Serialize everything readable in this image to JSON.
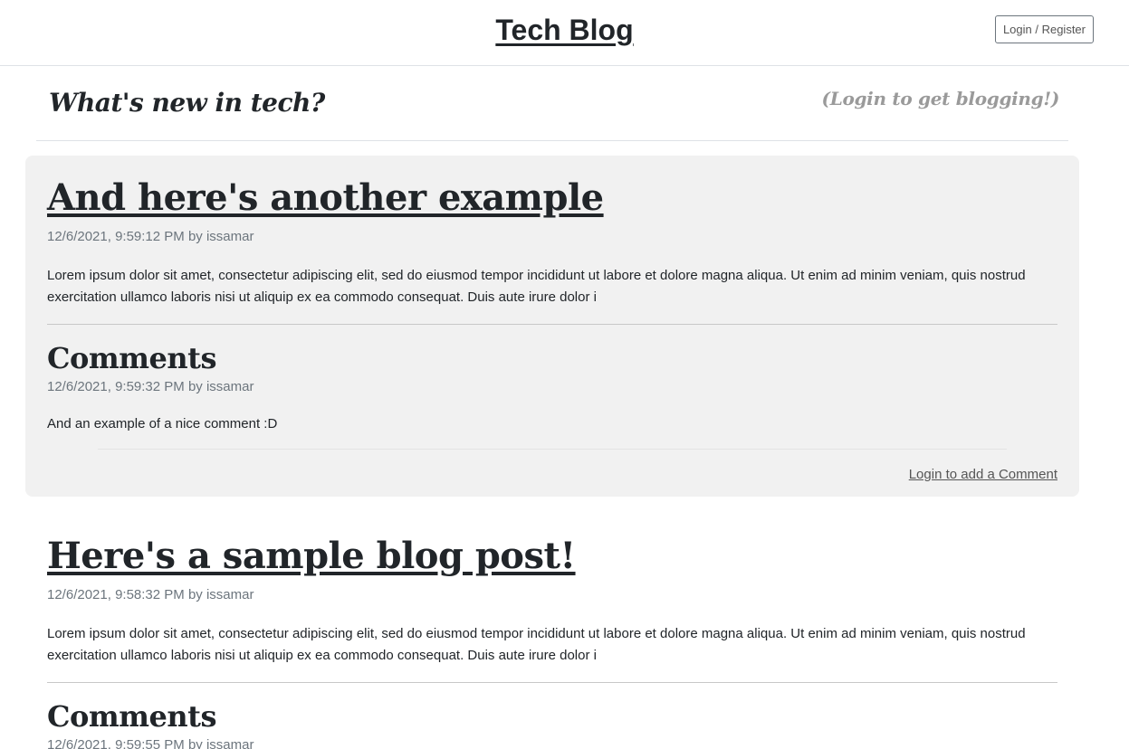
{
  "header": {
    "title": "Tech Blog",
    "login_button": "Login / Register"
  },
  "subheader": {
    "tagline": "What's new in tech?",
    "login_hint": "(Login to get blogging!)"
  },
  "posts": [
    {
      "title": "And here's another example",
      "meta": "12/6/2021, 9:59:12 PM by issamar",
      "body": "Lorem ipsum dolor sit amet, consectetur adipiscing elit, sed do eiusmod tempor incididunt ut labore et dolore magna aliqua. Ut enim ad minim veniam, quis nostrud exercitation ullamco laboris nisi ut aliquip ex ea commodo consequat. Duis aute irure dolor i",
      "comments_heading": "Comments",
      "comments": [
        {
          "meta": "12/6/2021, 9:59:32 PM by issamar",
          "text": "And an example of a nice comment :D"
        }
      ],
      "add_comment": "Login to add a Comment"
    },
    {
      "title": "Here's a sample blog post!",
      "meta": "12/6/2021, 9:58:32 PM by issamar",
      "body": "Lorem ipsum dolor sit amet, consectetur adipiscing elit, sed do eiusmod tempor incididunt ut labore et dolore magna aliqua. Ut enim ad minim veniam, quis nostrud exercitation ullamco laboris nisi ut aliquip ex ea commodo consequat. Duis aute irure dolor i",
      "comments_heading": "Comments",
      "comments": [
        {
          "meta": "12/6/2021, 9:59:55 PM by issamar"
        }
      ]
    }
  ]
}
